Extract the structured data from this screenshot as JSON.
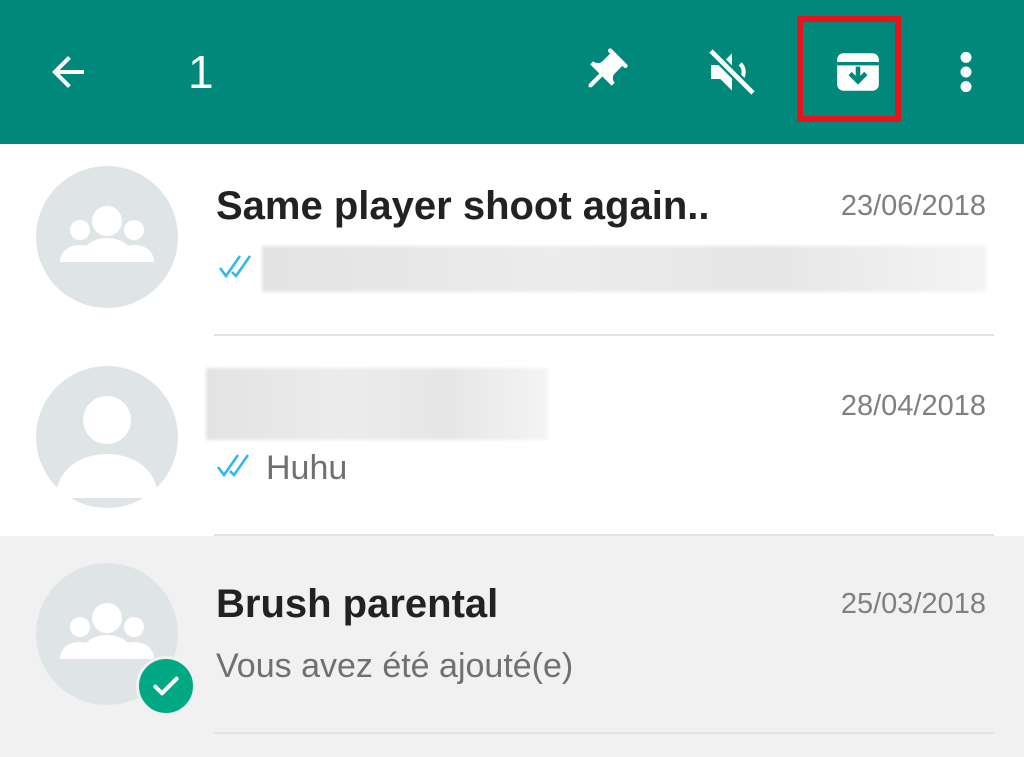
{
  "toolbar": {
    "selected_count": "1",
    "icons": {
      "back": "arrow-left-icon",
      "pin": "pin-icon",
      "mute": "speaker-muted-icon",
      "archive": "archive-icon",
      "more": "more-vertical-icon"
    },
    "background_color": "#00897b",
    "highlight_color": "#e8141b"
  },
  "chats": [
    {
      "name": "Same player shoot again..",
      "date": "23/06/2018",
      "preview": "",
      "avatar": "group-icon",
      "read_ticks": true,
      "preview_blurred": true
    },
    {
      "name": "",
      "date": "28/04/2018",
      "preview": "Huhu",
      "avatar": "person-icon",
      "read_ticks": true,
      "name_blurred": true
    },
    {
      "name": "Brush parental",
      "date": "25/03/2018",
      "preview": "Vous avez été ajouté(e)",
      "avatar": "group-icon",
      "selected": true
    }
  ],
  "colors": {
    "tick_blue": "#34b7f1",
    "selected_badge": "#00a884",
    "selected_row_bg": "#f1f1f1"
  }
}
